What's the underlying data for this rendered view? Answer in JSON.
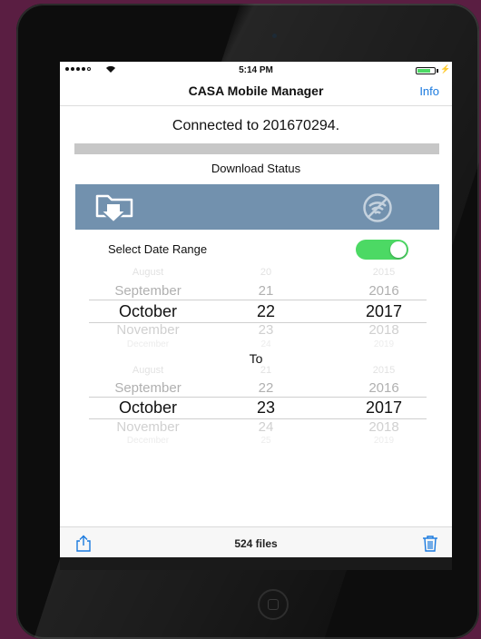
{
  "status_bar": {
    "time": "5:14 PM",
    "signal_icon": "signal-dots-icon",
    "wifi_icon": "wifi-icon",
    "battery_icon": "battery-icon"
  },
  "nav": {
    "title": "CASA Mobile Manager",
    "info_label": "Info"
  },
  "connection": {
    "text": "Connected to 201670294."
  },
  "download": {
    "progress": 0,
    "status_label": "Download Status"
  },
  "banner": {
    "left_icon": "folder-download-icon",
    "right_icon": "wifi-off-icon"
  },
  "date_range": {
    "label": "Select Date Range",
    "enabled": true
  },
  "from_picker": {
    "rows": [
      {
        "month": "August",
        "day": "20",
        "year": "2015"
      },
      {
        "month": "September",
        "day": "21",
        "year": "2016"
      },
      {
        "month": "October",
        "day": "22",
        "year": "2017"
      },
      {
        "month": "November",
        "day": "23",
        "year": "2018"
      },
      {
        "month": "December",
        "day": "24",
        "year": "2019"
      }
    ]
  },
  "to_label": "To",
  "to_picker": {
    "rows": [
      {
        "month": "August",
        "day": "21",
        "year": "2015"
      },
      {
        "month": "September",
        "day": "22",
        "year": "2016"
      },
      {
        "month": "October",
        "day": "23",
        "year": "2017"
      },
      {
        "month": "November",
        "day": "24",
        "year": "2018"
      },
      {
        "month": "December",
        "day": "25",
        "year": "2019"
      }
    ]
  },
  "toolbar": {
    "share_icon": "share-icon",
    "file_count": "524 files",
    "trash_icon": "trash-icon"
  },
  "colors": {
    "accent": "#1a7adf",
    "banner": "#7291ae",
    "toggle_on": "#4cd964",
    "progress_track": "#c7c7c7",
    "background": "#5a1e42"
  }
}
